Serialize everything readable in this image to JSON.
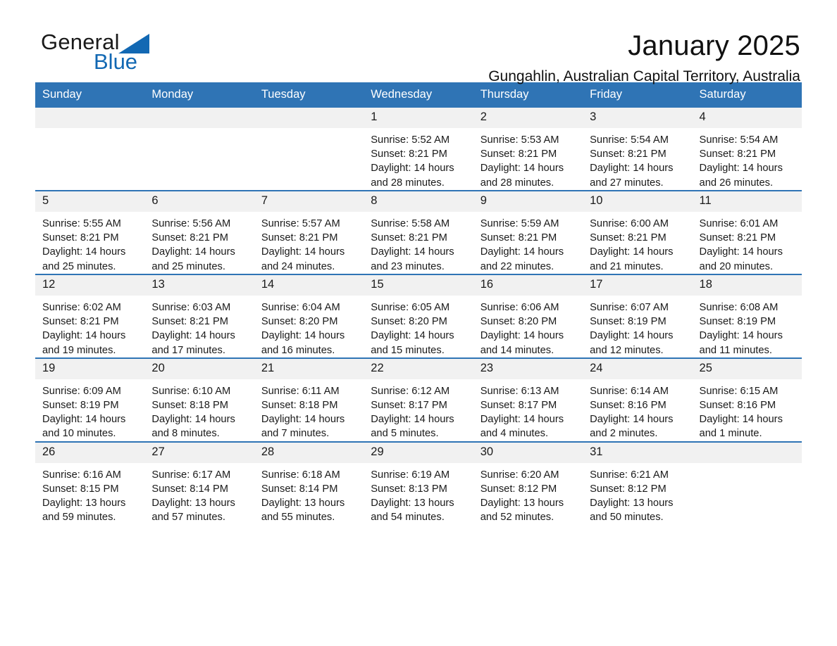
{
  "brand": {
    "name_part1": "General",
    "name_part2": "Blue",
    "accent_color": "#1268b3"
  },
  "header": {
    "title": "January 2025",
    "subtitle": "Gungahlin, Australian Capital Territory, Australia",
    "header_bg": "#2f74b5",
    "daynum_bg": "#f1f1f1"
  },
  "weekday_headers": [
    "Sunday",
    "Monday",
    "Tuesday",
    "Wednesday",
    "Thursday",
    "Friday",
    "Saturday"
  ],
  "weeks": [
    [
      {
        "day": "",
        "empty": true
      },
      {
        "day": "",
        "empty": true
      },
      {
        "day": "",
        "empty": true
      },
      {
        "day": "1",
        "sunrise": "Sunrise: 5:52 AM",
        "sunset": "Sunset: 8:21 PM",
        "daylight_line1": "Daylight: 14 hours",
        "daylight_line2": "and 28 minutes."
      },
      {
        "day": "2",
        "sunrise": "Sunrise: 5:53 AM",
        "sunset": "Sunset: 8:21 PM",
        "daylight_line1": "Daylight: 14 hours",
        "daylight_line2": "and 28 minutes."
      },
      {
        "day": "3",
        "sunrise": "Sunrise: 5:54 AM",
        "sunset": "Sunset: 8:21 PM",
        "daylight_line1": "Daylight: 14 hours",
        "daylight_line2": "and 27 minutes."
      },
      {
        "day": "4",
        "sunrise": "Sunrise: 5:54 AM",
        "sunset": "Sunset: 8:21 PM",
        "daylight_line1": "Daylight: 14 hours",
        "daylight_line2": "and 26 minutes."
      }
    ],
    [
      {
        "day": "5",
        "sunrise": "Sunrise: 5:55 AM",
        "sunset": "Sunset: 8:21 PM",
        "daylight_line1": "Daylight: 14 hours",
        "daylight_line2": "and 25 minutes."
      },
      {
        "day": "6",
        "sunrise": "Sunrise: 5:56 AM",
        "sunset": "Sunset: 8:21 PM",
        "daylight_line1": "Daylight: 14 hours",
        "daylight_line2": "and 25 minutes."
      },
      {
        "day": "7",
        "sunrise": "Sunrise: 5:57 AM",
        "sunset": "Sunset: 8:21 PM",
        "daylight_line1": "Daylight: 14 hours",
        "daylight_line2": "and 24 minutes."
      },
      {
        "day": "8",
        "sunrise": "Sunrise: 5:58 AM",
        "sunset": "Sunset: 8:21 PM",
        "daylight_line1": "Daylight: 14 hours",
        "daylight_line2": "and 23 minutes."
      },
      {
        "day": "9",
        "sunrise": "Sunrise: 5:59 AM",
        "sunset": "Sunset: 8:21 PM",
        "daylight_line1": "Daylight: 14 hours",
        "daylight_line2": "and 22 minutes."
      },
      {
        "day": "10",
        "sunrise": "Sunrise: 6:00 AM",
        "sunset": "Sunset: 8:21 PM",
        "daylight_line1": "Daylight: 14 hours",
        "daylight_line2": "and 21 minutes."
      },
      {
        "day": "11",
        "sunrise": "Sunrise: 6:01 AM",
        "sunset": "Sunset: 8:21 PM",
        "daylight_line1": "Daylight: 14 hours",
        "daylight_line2": "and 20 minutes."
      }
    ],
    [
      {
        "day": "12",
        "sunrise": "Sunrise: 6:02 AM",
        "sunset": "Sunset: 8:21 PM",
        "daylight_line1": "Daylight: 14 hours",
        "daylight_line2": "and 19 minutes."
      },
      {
        "day": "13",
        "sunrise": "Sunrise: 6:03 AM",
        "sunset": "Sunset: 8:21 PM",
        "daylight_line1": "Daylight: 14 hours",
        "daylight_line2": "and 17 minutes."
      },
      {
        "day": "14",
        "sunrise": "Sunrise: 6:04 AM",
        "sunset": "Sunset: 8:20 PM",
        "daylight_line1": "Daylight: 14 hours",
        "daylight_line2": "and 16 minutes."
      },
      {
        "day": "15",
        "sunrise": "Sunrise: 6:05 AM",
        "sunset": "Sunset: 8:20 PM",
        "daylight_line1": "Daylight: 14 hours",
        "daylight_line2": "and 15 minutes."
      },
      {
        "day": "16",
        "sunrise": "Sunrise: 6:06 AM",
        "sunset": "Sunset: 8:20 PM",
        "daylight_line1": "Daylight: 14 hours",
        "daylight_line2": "and 14 minutes."
      },
      {
        "day": "17",
        "sunrise": "Sunrise: 6:07 AM",
        "sunset": "Sunset: 8:19 PM",
        "daylight_line1": "Daylight: 14 hours",
        "daylight_line2": "and 12 minutes."
      },
      {
        "day": "18",
        "sunrise": "Sunrise: 6:08 AM",
        "sunset": "Sunset: 8:19 PM",
        "daylight_line1": "Daylight: 14 hours",
        "daylight_line2": "and 11 minutes."
      }
    ],
    [
      {
        "day": "19",
        "sunrise": "Sunrise: 6:09 AM",
        "sunset": "Sunset: 8:19 PM",
        "daylight_line1": "Daylight: 14 hours",
        "daylight_line2": "and 10 minutes."
      },
      {
        "day": "20",
        "sunrise": "Sunrise: 6:10 AM",
        "sunset": "Sunset: 8:18 PM",
        "daylight_line1": "Daylight: 14 hours",
        "daylight_line2": "and 8 minutes."
      },
      {
        "day": "21",
        "sunrise": "Sunrise: 6:11 AM",
        "sunset": "Sunset: 8:18 PM",
        "daylight_line1": "Daylight: 14 hours",
        "daylight_line2": "and 7 minutes."
      },
      {
        "day": "22",
        "sunrise": "Sunrise: 6:12 AM",
        "sunset": "Sunset: 8:17 PM",
        "daylight_line1": "Daylight: 14 hours",
        "daylight_line2": "and 5 minutes."
      },
      {
        "day": "23",
        "sunrise": "Sunrise: 6:13 AM",
        "sunset": "Sunset: 8:17 PM",
        "daylight_line1": "Daylight: 14 hours",
        "daylight_line2": "and 4 minutes."
      },
      {
        "day": "24",
        "sunrise": "Sunrise: 6:14 AM",
        "sunset": "Sunset: 8:16 PM",
        "daylight_line1": "Daylight: 14 hours",
        "daylight_line2": "and 2 minutes."
      },
      {
        "day": "25",
        "sunrise": "Sunrise: 6:15 AM",
        "sunset": "Sunset: 8:16 PM",
        "daylight_line1": "Daylight: 14 hours",
        "daylight_line2": "and 1 minute."
      }
    ],
    [
      {
        "day": "26",
        "sunrise": "Sunrise: 6:16 AM",
        "sunset": "Sunset: 8:15 PM",
        "daylight_line1": "Daylight: 13 hours",
        "daylight_line2": "and 59 minutes."
      },
      {
        "day": "27",
        "sunrise": "Sunrise: 6:17 AM",
        "sunset": "Sunset: 8:14 PM",
        "daylight_line1": "Daylight: 13 hours",
        "daylight_line2": "and 57 minutes."
      },
      {
        "day": "28",
        "sunrise": "Sunrise: 6:18 AM",
        "sunset": "Sunset: 8:14 PM",
        "daylight_line1": "Daylight: 13 hours",
        "daylight_line2": "and 55 minutes."
      },
      {
        "day": "29",
        "sunrise": "Sunrise: 6:19 AM",
        "sunset": "Sunset: 8:13 PM",
        "daylight_line1": "Daylight: 13 hours",
        "daylight_line2": "and 54 minutes."
      },
      {
        "day": "30",
        "sunrise": "Sunrise: 6:20 AM",
        "sunset": "Sunset: 8:12 PM",
        "daylight_line1": "Daylight: 13 hours",
        "daylight_line2": "and 52 minutes."
      },
      {
        "day": "31",
        "sunrise": "Sunrise: 6:21 AM",
        "sunset": "Sunset: 8:12 PM",
        "daylight_line1": "Daylight: 13 hours",
        "daylight_line2": "and 50 minutes."
      },
      {
        "day": "",
        "empty": true
      }
    ]
  ]
}
